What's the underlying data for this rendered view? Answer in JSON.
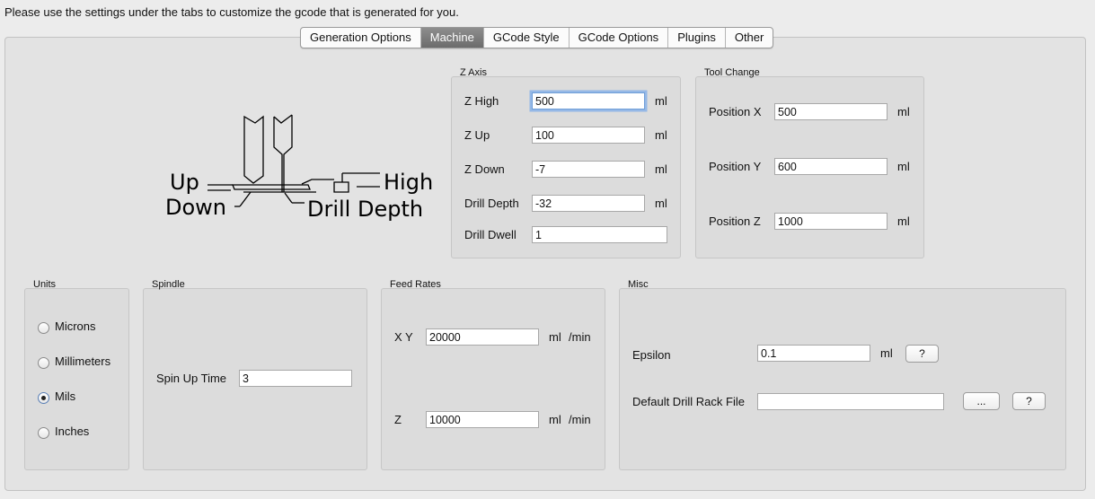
{
  "intro_text": "Please use the settings under the tabs to customize the gcode that is generated for you.",
  "tabs": [
    {
      "label": "Generation Options",
      "selected": false
    },
    {
      "label": "Machine",
      "selected": true
    },
    {
      "label": "GCode Style",
      "selected": false
    },
    {
      "label": "GCode Options",
      "selected": false
    },
    {
      "label": "Plugins",
      "selected": false
    },
    {
      "label": "Other",
      "selected": false
    }
  ],
  "diagram": {
    "labels": {
      "up": "Up",
      "down": "Down",
      "high": "High",
      "drill_depth": "Drill Depth"
    }
  },
  "z_axis": {
    "title": "Z Axis",
    "z_high": {
      "label": "Z High",
      "value": "500",
      "unit": "ml"
    },
    "z_up": {
      "label": "Z Up",
      "value": "100",
      "unit": "ml"
    },
    "z_down": {
      "label": "Z Down",
      "value": "-7",
      "unit": "ml"
    },
    "drill_depth": {
      "label": "Drill Depth",
      "value": "-32",
      "unit": "ml"
    },
    "drill_dwell": {
      "label": "Drill Dwell",
      "value": "1"
    }
  },
  "tool_change": {
    "title": "Tool Change",
    "position_x": {
      "label": "Position X",
      "value": "500",
      "unit": "ml"
    },
    "position_y": {
      "label": "Position Y",
      "value": "600",
      "unit": "ml"
    },
    "position_z": {
      "label": "Position Z",
      "value": "1000",
      "unit": "ml"
    }
  },
  "units": {
    "title": "Units",
    "options": [
      "Microns",
      "Millimeters",
      "Mils",
      "Inches"
    ],
    "selected": "Mils"
  },
  "spindle": {
    "title": "Spindle",
    "spin_up_time": {
      "label": "Spin Up Time",
      "value": "3"
    }
  },
  "feed_rates": {
    "title": "Feed Rates",
    "xy": {
      "label": "X Y",
      "value": "20000",
      "unit": "ml",
      "per": "/min"
    },
    "z": {
      "label": "Z",
      "value": "10000",
      "unit": "ml",
      "per": "/min"
    }
  },
  "misc": {
    "title": "Misc",
    "epsilon": {
      "label": "Epsilon",
      "value": "0.1",
      "unit": "ml",
      "help": "?"
    },
    "drill_rack": {
      "label": "Default Drill Rack File",
      "value": "",
      "browse": "...",
      "help": "?"
    }
  }
}
